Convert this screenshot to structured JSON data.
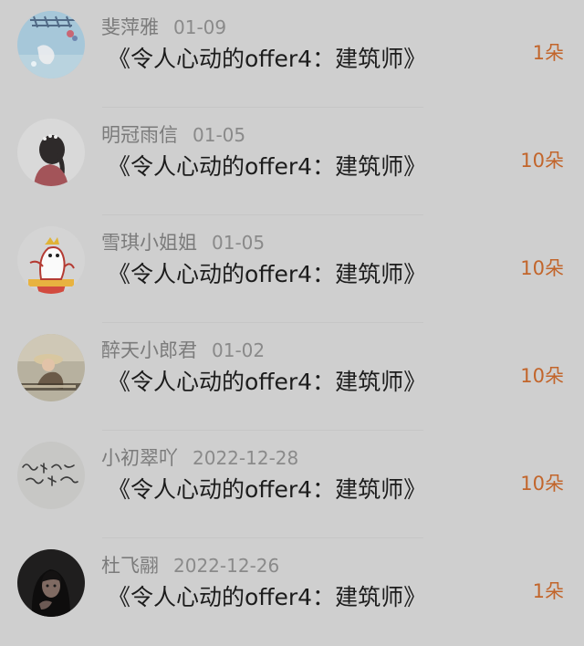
{
  "colors": {
    "background": "#cfcfcf",
    "username": "#7b7b7b",
    "date": "#8a8a8a",
    "title": "#1c1c1c",
    "gift_count": "#c2652b"
  },
  "entries": [
    {
      "username": "斐萍雅",
      "date": "01-09",
      "title": "《令人心动的offer4：建筑师》",
      "gift": "1朵",
      "avatar_icon": "avatar-sky-decor-icon"
    },
    {
      "username": "明冠雨信",
      "date": "01-05",
      "title": "《令人心动的offer4：建筑师》",
      "gift": "10朵",
      "avatar_icon": "avatar-girl-braid-icon"
    },
    {
      "username": "雪琪小姐姐",
      "date": "01-05",
      "title": "《令人心动的offer4：建筑师》",
      "gift": "10朵",
      "avatar_icon": "avatar-cartoon-queen-icon"
    },
    {
      "username": "醉天小郎君",
      "date": "01-02",
      "title": "《令人心动的offer4：建筑师》",
      "gift": "10朵",
      "avatar_icon": "avatar-photo-hat-icon"
    },
    {
      "username": "小初翠吖",
      "date": "2022-12-28",
      "title": "《令人心动的offer4：建筑师》",
      "gift": "10朵",
      "avatar_icon": "avatar-handwriting-icon"
    },
    {
      "username": "杜飞翮",
      "date": "2022-12-26",
      "title": "《令人心动的offer4：建筑师》",
      "gift": "1朵",
      "avatar_icon": "avatar-dark-portrait-icon"
    }
  ]
}
